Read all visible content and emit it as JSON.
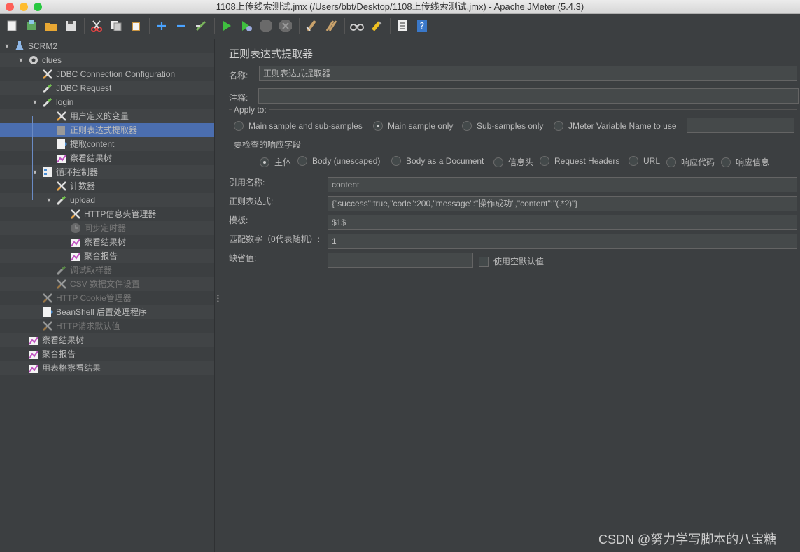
{
  "window": {
    "title": "1108上传线索测试.jmx (/Users/bbt/Desktop/1108上传线索测试.jmx) - Apache JMeter (5.4.3)"
  },
  "toolbar": {
    "items": [
      "new-icon",
      "templates-icon",
      "open-icon",
      "save-icon",
      "cut-icon",
      "copy-icon",
      "paste-icon",
      "expand-icon",
      "collapse-icon",
      "toggle-icon",
      "start-icon",
      "start-no-pause-icon",
      "stop-icon",
      "shutdown-icon",
      "clear-icon",
      "clear-all-icon",
      "search-icon",
      "reset-search-icon",
      "function-helper-icon",
      "help-icon"
    ]
  },
  "tree": {
    "items": [
      {
        "label": "SCRM2",
        "icon": "test-plan-icon",
        "twisty": "open"
      },
      {
        "label": "clues",
        "icon": "thread-group-icon",
        "twisty": "open"
      },
      {
        "label": "JDBC Connection Configuration",
        "icon": "config-element-icon"
      },
      {
        "label": "JDBC Request",
        "icon": "sampler-icon"
      },
      {
        "label": "login",
        "icon": "sampler-icon",
        "twisty": "open"
      },
      {
        "label": "用户定义的变量",
        "icon": "config-element-icon"
      },
      {
        "label": "正则表达式提取器",
        "icon": "extractor-icon",
        "selected": true
      },
      {
        "label": "提取content",
        "icon": "postprocessor-icon"
      },
      {
        "label": "察看结果树",
        "icon": "listener-icon"
      },
      {
        "label": "循环控制器",
        "icon": "controller-icon",
        "twisty": "open"
      },
      {
        "label": "计数器",
        "icon": "config-element-icon"
      },
      {
        "label": "upload",
        "icon": "sampler-icon",
        "twisty": "open"
      },
      {
        "label": "HTTP信息头管理器",
        "icon": "config-element-icon"
      },
      {
        "label": "同步定时器",
        "icon": "timer-icon",
        "disabled": true
      },
      {
        "label": "察看结果树",
        "icon": "listener-icon"
      },
      {
        "label": "聚合报告",
        "icon": "listener-icon"
      },
      {
        "label": "调试取样器",
        "icon": "sampler-icon",
        "disabled": true
      },
      {
        "label": "CSV 数据文件设置",
        "icon": "config-element-icon",
        "disabled": true
      },
      {
        "label": "HTTP Cookie管理器",
        "icon": "config-element-icon",
        "disabled": true
      },
      {
        "label": "BeanShell 后置处理程序",
        "icon": "postprocessor-icon"
      },
      {
        "label": "HTTP请求默认值",
        "icon": "config-element-icon",
        "disabled": true
      },
      {
        "label": "察看结果树",
        "icon": "listener-icon"
      },
      {
        "label": "聚合报告",
        "icon": "listener-icon"
      },
      {
        "label": "用表格察看结果",
        "icon": "listener-icon"
      }
    ]
  },
  "panel": {
    "title": "正则表达式提取器",
    "name_label": "名称:",
    "name_value": "正则表达式提取器",
    "comment_label": "注释:",
    "comment_value": "",
    "apply_to": {
      "legend": "Apply to:",
      "options": [
        "Main sample and sub-samples",
        "Main sample only",
        "Sub-samples only",
        "JMeter Variable Name to use"
      ],
      "selected": 1,
      "var_value": ""
    },
    "field": {
      "legend": "要检查的响应字段",
      "options": [
        "主体",
        "Body (unescaped)",
        "Body as a Document",
        "信息头",
        "Request Headers",
        "URL",
        "响应代码",
        "响应信息"
      ],
      "selected": 0
    },
    "ref_label": "引用名称:",
    "ref_value": "content",
    "regex_label": "正则表达式:",
    "regex_value": "{\"success\":true,\"code\":200,\"message\":\"操作成功\",\"content\":\"(.*?)\"}",
    "template_label": "模板:",
    "template_value": "$1$",
    "match_label": "匹配数字（0代表随机）:",
    "match_value": "1",
    "default_label": "缺省值:",
    "default_value": "",
    "empty_default_label": "使用空默认值"
  },
  "watermark": "CSDN @努力学写脚本的八宝糖"
}
